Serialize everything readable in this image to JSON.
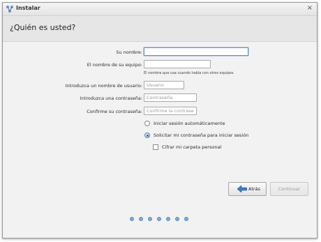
{
  "window": {
    "title": "Instalar",
    "app_icon": "installer-icon",
    "close_symbol": "×"
  },
  "header": {
    "title": "¿Quién es usted?"
  },
  "form": {
    "name_label": "Su nombre:",
    "name_value": "",
    "computer_label": "El nombre de su equipo:",
    "computer_value": "",
    "computer_hint": "El nombre que usa cuando habla con otros equipos.",
    "username_label": "Introduzca un nombre de usuario:",
    "username_placeholder": "Usuario",
    "password_label": "Introduzca una contraseña:",
    "password_placeholder": "Contraseña",
    "confirm_label": "Confirme su contraseña:",
    "confirm_placeholder": "Confirme la contraseña"
  },
  "options": {
    "auto_login_label": "Iniciar sesión automáticamente",
    "auto_login_checked": false,
    "require_password_label": "Solicitar mi contraseña para iniciar sesión",
    "require_password_checked": true,
    "encrypt_home_label": "Cifrar mi carpeta personal",
    "encrypt_home_checked": false
  },
  "buttons": {
    "back_label": "Atrás",
    "back_icon": "arrow-left-icon",
    "next_label": "Continuar",
    "next_enabled": false
  },
  "progress": {
    "total_steps": 7
  },
  "colors": {
    "accent": "#4a7fbf",
    "dot": "#7fa9d8"
  }
}
